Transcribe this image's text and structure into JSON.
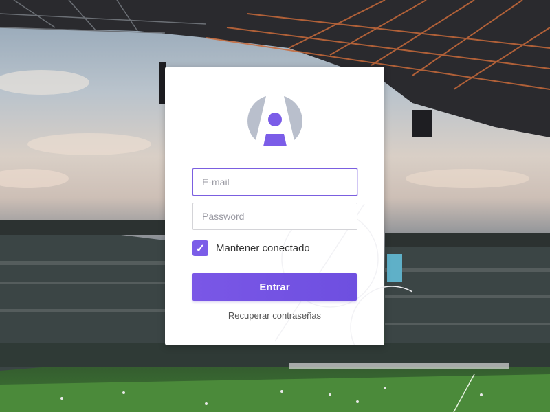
{
  "login": {
    "email_placeholder": "E-mail",
    "password_placeholder": "Password",
    "remember_label": "Mantener conectado",
    "remember_checked": true,
    "checkmark": "✓",
    "submit_label": "Entrar",
    "recover_label": "Recuperar contraseñas"
  },
  "colors": {
    "accent": "#7b5de8",
    "logo_grey": "#b9bfcc"
  }
}
